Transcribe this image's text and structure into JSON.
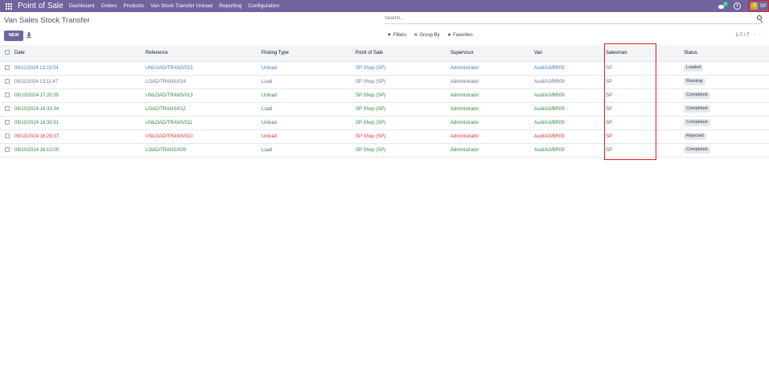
{
  "navbar": {
    "app_title": "Point of Sale",
    "menu": [
      "Dashboard",
      "Orders",
      "Products",
      "Van Stock Transfer Unload",
      "Reporting",
      "Configuration"
    ],
    "chat_badge_count": "2",
    "user_initial": "S",
    "user_name": "SP"
  },
  "control": {
    "breadcrumb": "Van Sales Stock Transfer",
    "new_label": "NEW",
    "search_placeholder": "Search...",
    "filters_label": "Filters",
    "group_by_label": "Group By",
    "favorites_label": "Favorites",
    "pager": "1-7 / 7"
  },
  "table": {
    "columns": [
      "Date",
      "Reference",
      "Picking Type",
      "Point of Sale",
      "Supervisor",
      "Van",
      "Salesman",
      "Status"
    ],
    "rows": [
      {
        "date": "09/11/2024 13:23:04",
        "reference": "UNLOAD/TRANS/015",
        "picking_type": "Unload",
        "pos": "SP Shop (SP)",
        "supervisor": "Administrator",
        "van": "Audi/A3/BR09",
        "salesman": "SP",
        "status": "Loaded",
        "color": "#3b82c4"
      },
      {
        "date": "09/11/2024 13:11:47",
        "reference": "LOAD/TRANS/014",
        "picking_type": "Load",
        "pos": "SP Shop (SP)",
        "supervisor": "Administrator",
        "van": "Audi/A3/BR09",
        "salesman": "SP",
        "status": "Running",
        "color": "#6b7280"
      },
      {
        "date": "09/10/2024 17:20:35",
        "reference": "UNLOAD/TRANS/013",
        "picking_type": "Unload",
        "pos": "SP Shop (SP)",
        "supervisor": "Administrator",
        "van": "Audi/A3/BR09",
        "salesman": "SP",
        "status": "Completed",
        "color": "#2e8b3e"
      },
      {
        "date": "09/10/2024 16:33:34",
        "reference": "LOAD/TRANS/012",
        "picking_type": "Load",
        "pos": "SP Shop (SP)",
        "supervisor": "Administrator",
        "van": "Audi/A3/BR09",
        "salesman": "SP",
        "status": "Completed",
        "color": "#2e8b3e"
      },
      {
        "date": "09/10/2024 16:30:31",
        "reference": "UNLOAD/TRANS/011",
        "picking_type": "Unload",
        "pos": "SP Shop (SP)",
        "supervisor": "Administrator",
        "van": "Audi/A3/BR09",
        "salesman": "SP",
        "status": "Completed",
        "color": "#2e8b3e"
      },
      {
        "date": "09/10/2024 16:29:37",
        "reference": "UNLOAD/TRANS/010",
        "picking_type": "Unload",
        "pos": "SP Shop (SP)",
        "supervisor": "Administrator",
        "van": "Audi/A3/BR09",
        "salesman": "SP",
        "status": "Rejected",
        "color": "#dc3545"
      },
      {
        "date": "09/10/2024 16:10:00",
        "reference": "LOAD/TRANS/009",
        "picking_type": "Load",
        "pos": "SP Shop (SP)",
        "supervisor": "Administrator",
        "van": "Audi/A3/BR09",
        "salesman": "SP",
        "status": "Completed",
        "color": "#2e8b3e"
      }
    ]
  },
  "colors": {
    "brand": "#71639e",
    "highlight": "#e11d1d",
    "avatar": "#d4a82b"
  },
  "icons": [
    "apps-grid-icon",
    "chat-icon",
    "clock-icon",
    "download-icon",
    "search-icon",
    "filter-icon",
    "group-by-icon",
    "star-icon",
    "chevron-left-icon",
    "chevron-right-icon"
  ]
}
